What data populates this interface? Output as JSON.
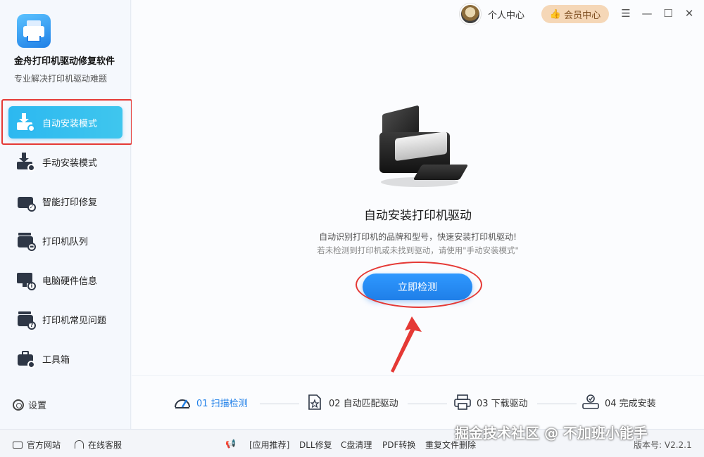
{
  "sidebar": {
    "app_title": "金舟打印机驱动修复软件",
    "app_subtitle": "专业解决打印机驱动难题",
    "items": [
      {
        "label": "自动安装模式",
        "active": true
      },
      {
        "label": "手动安装模式",
        "active": false
      },
      {
        "label": "智能打印修复",
        "active": false
      },
      {
        "label": "打印机队列",
        "active": false
      },
      {
        "label": "电脑硬件信息",
        "active": false
      },
      {
        "label": "打印机常见问题",
        "active": false
      },
      {
        "label": "工具箱",
        "active": false
      }
    ],
    "settings_label": "设置"
  },
  "topbar": {
    "user_center": "个人中心",
    "vip_center": "会员中心"
  },
  "main": {
    "title": "自动安装打印机驱动",
    "desc1": "自动识别打印机的品牌和型号，快速安装打印机驱动!",
    "desc2": "若未检测到打印机或未找到驱动，请使用\"手动安装模式\"",
    "detect_button": "立即检测"
  },
  "steps": [
    {
      "label": "01 扫描检测",
      "active": true
    },
    {
      "label": "02 自动匹配驱动",
      "active": false
    },
    {
      "label": "03 下载驱动",
      "active": false
    },
    {
      "label": "04 完成安装",
      "active": false
    }
  ],
  "footer": {
    "official_site": "官方网站",
    "online_service": "在线客服",
    "recommend": "[应用推荐]",
    "dll_fix": "DLL修复",
    "c_clean": "C盘清理",
    "pdf_convert": "PDF转换",
    "dup_delete": "重复文件删除",
    "version": "版本号: V2.2.1"
  },
  "watermark": "掘金技术社区 @ 不加班小能手",
  "colors": {
    "accent": "#1f7fe8",
    "active_nav": "#2cb8f0",
    "annotation_red": "#e53935",
    "vip_bg": "#f5d7b7"
  }
}
